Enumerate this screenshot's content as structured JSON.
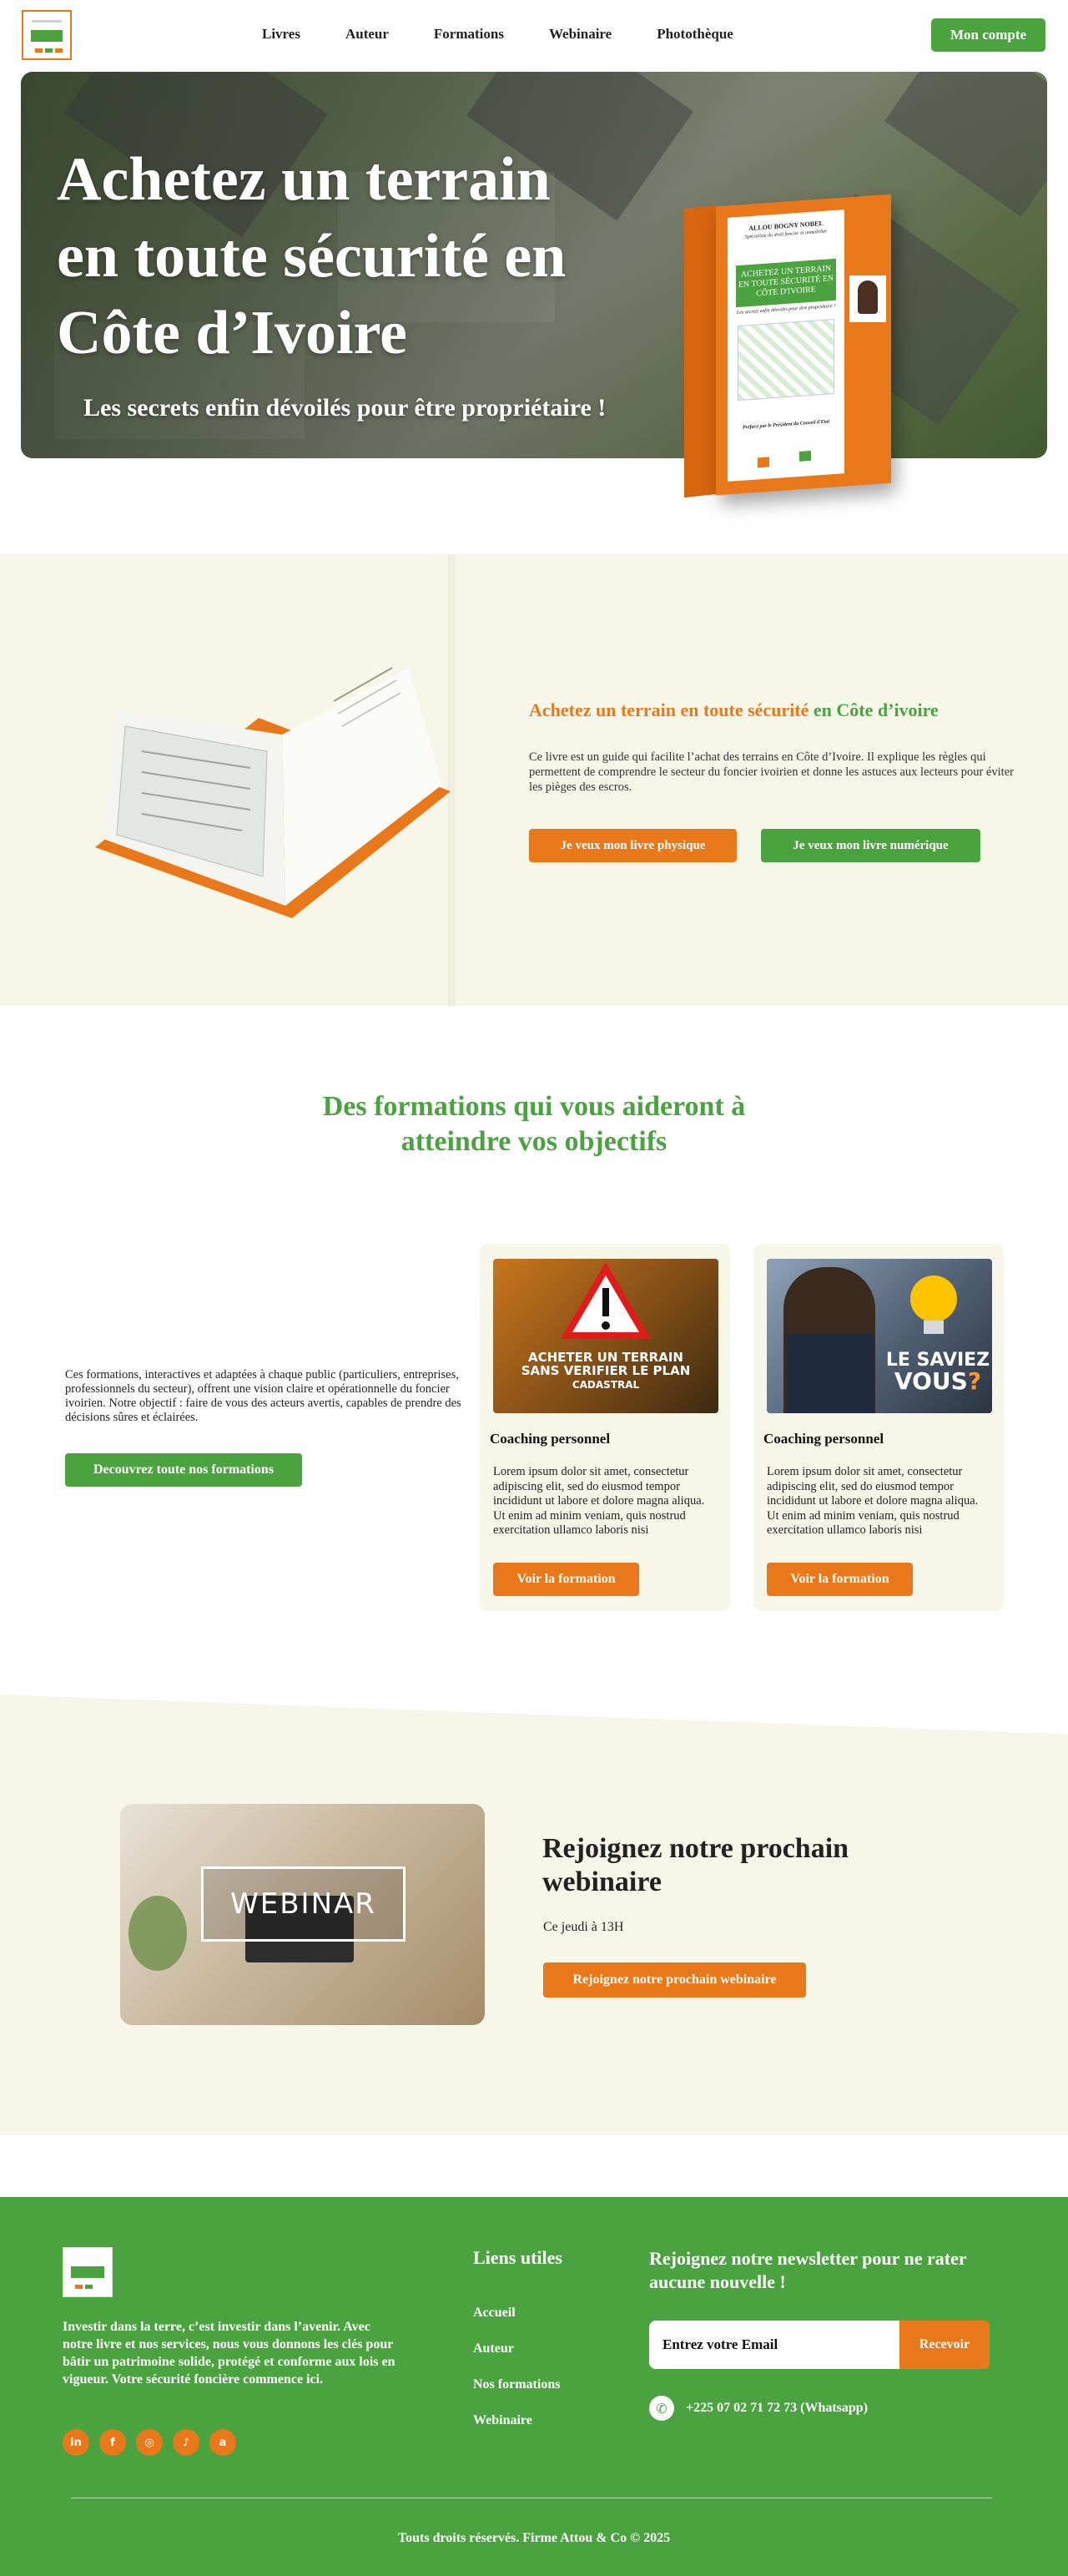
{
  "nav": {
    "items": [
      "Livres",
      "Auteur",
      "Formations",
      "Webinaire",
      "Photothèque"
    ],
    "account_button": "Mon compte"
  },
  "hero": {
    "title_line1": "Achetez un terrain",
    "title_line2": "en toute sécurité en",
    "title_line3": "Côte d’Ivoire",
    "subtitle": "Les secrets enfin dévoilés pour être propriétaire !",
    "book": {
      "author": "ALLOU BOGNY NOBEL",
      "author_role": "Spécialiste du droit foncier et immobilier",
      "title": "ACHETEZ UN TERRAIN EN TOUTE SÉCURITÉ EN CÔTE D'IVOIRE",
      "tagline": "Les secrets enfin dévoilés pour être propriétaire !",
      "preface": "Préfacé par le Président du Conseil d'Etat"
    }
  },
  "book_section": {
    "title_orange": "Achetez un terrain en toute sécurité",
    "title_green": " en Côte d’ivoire",
    "description": "Ce livre est un guide qui facilite l’achat des terrains en Côte d’Ivoire. Il explique les règles qui permettent de comprendre le secteur du foncier ivoirien et donne les astuces aux lecteurs pour éviter les pièges des escros.",
    "btn_physical": "Je veux mon livre physique",
    "btn_digital": "Je veux mon livre numérique"
  },
  "formations": {
    "title_line1": "Des formations qui vous aideront à",
    "title_line2": "atteindre vos objectifs",
    "description": "Ces formations, interactives et adaptées à chaque public (particuliers, entreprises, professionnels du secteur), offrent une vision claire et opérationnelle du foncier ivoirien. Notre objectif : faire de vous des acteurs avertis, capables de prendre des décisions sûres et éclairées.",
    "cta": "Decouvrez toute nos formations",
    "cards": [
      {
        "image_text_line1": "ACHETER UN TERRAIN",
        "image_text_line2": "SANS VERIFIER LE PLAN",
        "image_text_line3": "CADASTRAL",
        "title": "Coaching personnel",
        "body": "Lorem ipsum dolor sit amet, consectetur adipiscing elit, sed do eiusmod tempor incididunt ut labore et dolore magna aliqua. Ut enim ad minim veniam, quis nostrud exercitation ullamco laboris nisi",
        "button": "Voir la formation"
      },
      {
        "image_text_line1": "LE SAVIEZ",
        "image_text_line2": "VOUS",
        "title": "Coaching personnel",
        "body": "Lorem ipsum dolor sit amet, consectetur adipiscing elit, sed do eiusmod tempor incididunt ut labore et dolore magna aliqua. Ut enim ad minim veniam, quis nostrud exercitation ullamco laboris nisi",
        "button": "Voir la formation"
      }
    ]
  },
  "webinar": {
    "image_label": "WEBINAR",
    "title": "Rejoignez notre prochain webinaire",
    "time": "Ce jeudi à 13H",
    "button": "Rejoignez notre prochain webinaire"
  },
  "footer": {
    "tagline": "Investir dans la terre, c’est investir dans l’avenir. Avec notre livre et nos services, nous vous donnons les clés pour bâtir un patrimoine solide, protégé et conforme aux lois en vigueur. Votre sécurité foncière commence ici.",
    "links_title": "Liens utiles",
    "links": [
      "Accueil",
      "Auteur",
      "Nos formations",
      "Webinaire"
    ],
    "newsletter_title": "Rejoignez notre newsletter pour ne rater aucune nouvelle !",
    "newsletter_placeholder": "Entrez votre Email",
    "newsletter_button": "Recevoir",
    "whatsapp": "+225 07 02 71 72 73 (Whatsapp)",
    "socials": [
      "linkedin-icon",
      "facebook-icon",
      "instagram-icon",
      "tiktok-icon",
      "amazon-icon"
    ],
    "copyright": "Touts droits réservés. Firme Attou & Co © 2025"
  },
  "colors": {
    "green": "#4ba33f",
    "orange": "#e9781a",
    "cream": "#f7f7e9"
  }
}
